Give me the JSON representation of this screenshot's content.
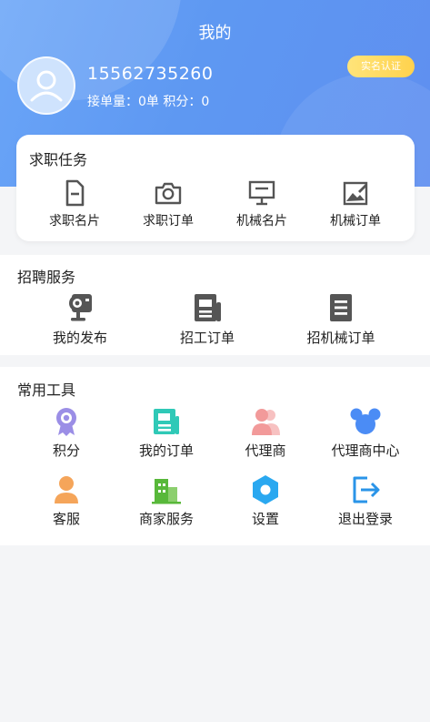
{
  "header": {
    "title": "我的",
    "phone": "15562735260",
    "stats": "接单量：0单  积分：0",
    "verify_label": "实名认证"
  },
  "job_tasks": {
    "title": "求职任务",
    "items": [
      {
        "label": "求职名片",
        "icon": "document-icon"
      },
      {
        "label": "求职订单",
        "icon": "camera-icon"
      },
      {
        "label": "机械名片",
        "icon": "monitor-icon"
      },
      {
        "label": "机械订单",
        "icon": "image-edit-icon"
      }
    ]
  },
  "recruit": {
    "title": "招聘服务",
    "items": [
      {
        "label": "我的发布",
        "icon": "projector-icon"
      },
      {
        "label": "招工订单",
        "icon": "newspaper-icon"
      },
      {
        "label": "招机械订单",
        "icon": "list-document-icon"
      }
    ]
  },
  "tools": {
    "title": "常用工具",
    "items": [
      {
        "label": "积分",
        "icon": "medal-icon"
      },
      {
        "label": "我的订单",
        "icon": "order-icon"
      },
      {
        "label": "代理商",
        "icon": "users-icon"
      },
      {
        "label": "代理商中心",
        "icon": "mickey-icon"
      },
      {
        "label": "客服",
        "icon": "user-icon"
      },
      {
        "label": "商家服务",
        "icon": "buildings-icon"
      },
      {
        "label": "设置",
        "icon": "gear-icon"
      },
      {
        "label": "退出登录",
        "icon": "logout-icon"
      }
    ]
  },
  "colors": {
    "header_blue": "#5e98f2",
    "verify_yellow": "#ffd24d",
    "medal_purple": "#9b8ee6",
    "order_teal": "#2fc9b7",
    "agent_pink": "#f29a9a",
    "center_blue": "#4b8cf5",
    "service_orange": "#f5a55a",
    "merchant_green": "#58b83a",
    "settings_blue": "#2aa8f0",
    "logout_blue": "#2a94e8"
  }
}
